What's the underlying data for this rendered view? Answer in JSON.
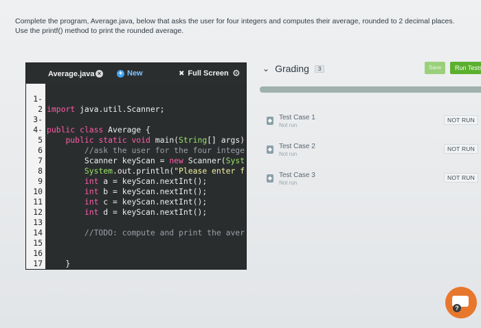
{
  "instructions": {
    "line1": "Complete the program, Average.java, below that asks the user for four integers and computes their average, rounded to 2 decimal places.",
    "line2": "Use the printf() method to print the rounded average."
  },
  "editor": {
    "file_tab": "Average.java",
    "close_glyph": "×",
    "new_label": "New",
    "new_glyph": "+",
    "fullscreen_label": "Full Screen",
    "fullscreen_icon": "✖",
    "settings_icon": "⚙",
    "line_numbers": [
      "1-",
      "2",
      "3-",
      "4-",
      "5",
      "6",
      "7",
      "8",
      "9",
      "10",
      "11",
      "12",
      "13",
      "14",
      "15",
      "16",
      "17"
    ]
  },
  "code": {
    "l1_kw": "import",
    "l1_rest": " java.util.Scanner;",
    "l3_kw": "public class",
    "l3_rest": " Average {",
    "l4_indent": "    ",
    "l4_kw": "public static void",
    "l4_rest": " main(",
    "l4_type": "String",
    "l4_arr": "[] args)",
    "l5": "        //ask the user for the four intege",
    "l6_a": "        Scanner keyScan = ",
    "l6_kw": "new",
    "l6_b": " Scanner(",
    "l6_cls": "Syst",
    "l7_indent": "        ",
    "l7_cls": "System",
    "l7_b": ".out.println(",
    "l7_str": "\"Please enter f",
    "l8_indent": "        ",
    "l8_kw": "int",
    "l8_rest": " a = keyScan.nextInt();",
    "l9_indent": "        ",
    "l9_kw": "int",
    "l9_rest": " b = keyScan.nextInt();",
    "l10_indent": "        ",
    "l10_kw": "int",
    "l10_rest": " c = keyScan.nextInt();",
    "l11_indent": "        ",
    "l11_kw": "int",
    "l11_rest": " d = keyScan.nextInt();",
    "l13": "        //TODO: compute and print the aver",
    "l16": "    }",
    "l17": "}"
  },
  "grading": {
    "chevron": "⌄",
    "title": "Grading",
    "count": "3",
    "save_label": "Save",
    "run_label": "Run Tests",
    "tests": [
      {
        "name": "Test Case 1",
        "status": "Not run",
        "badge": "NOT RUN",
        "icon": "◆"
      },
      {
        "name": "Test Case 2",
        "status": "Not run",
        "badge": "NOT RUN",
        "icon": "◆"
      },
      {
        "name": "Test Case 3",
        "status": "Not run",
        "badge": "NOT RUN",
        "icon": "◆"
      }
    ]
  },
  "help": {
    "glyph": "?"
  }
}
